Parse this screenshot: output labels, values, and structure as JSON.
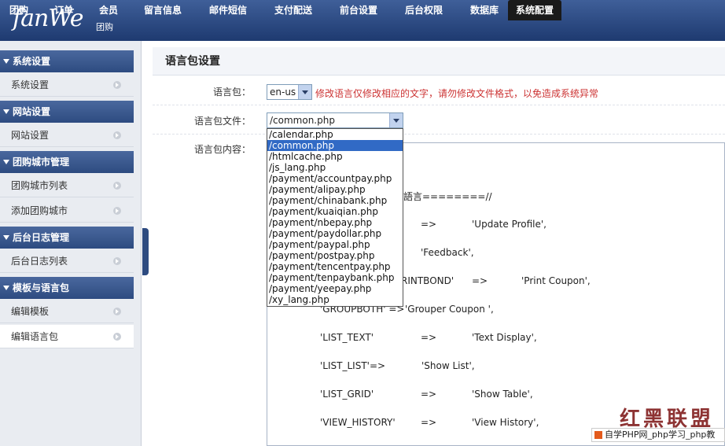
{
  "brand": {
    "logo": "fanWe",
    "sub": "团购"
  },
  "nav": [
    {
      "label": "团购",
      "active": false
    },
    {
      "label": "订单",
      "active": false
    },
    {
      "label": "会员",
      "active": false
    },
    {
      "label": "留言信息",
      "active": false
    },
    {
      "label": "邮件短信",
      "active": false
    },
    {
      "label": "支付配送",
      "active": false
    },
    {
      "label": "前台设置",
      "active": false
    },
    {
      "label": "后台权限",
      "active": false
    },
    {
      "label": "数据库",
      "active": false
    },
    {
      "label": "系统配置",
      "active": true
    }
  ],
  "sidebar": {
    "sections": [
      {
        "title": "系统设置",
        "items": [
          "系统设置"
        ]
      },
      {
        "title": "网站设置",
        "items": [
          "网站设置"
        ]
      },
      {
        "title": "团购城市管理",
        "items": [
          "团购城市列表",
          "添加团购城市"
        ]
      },
      {
        "title": "后台日志管理",
        "items": [
          "后台日志列表"
        ]
      },
      {
        "title": "模板与语言包",
        "items": [
          "编辑模板",
          "编辑语言包"
        ]
      }
    ],
    "current": "编辑语言包"
  },
  "main": {
    "title": "语言包设置",
    "lang_label": "语言包：",
    "lang_value": "en-us",
    "warning": "修改语言仅修改相应的文字，请勿修改文件格式，以免造成系统异常",
    "file_label": "语言包文件：",
    "file_value": "/common.php",
    "content_label": "语言包内容：",
    "file_options": [
      "/calendar.php",
      "/common.php",
      "/htmlcache.php",
      "/js_lang.php",
      "/payment/accountpay.php",
      "/payment/alipay.php",
      "/payment/chinabank.php",
      "/payment/kuaiqian.php",
      "/payment/nbepay.php",
      "/payment/paydollar.php",
      "/payment/paypal.php",
      "/payment/postpay.php",
      "/payment/tencentpay.php",
      "/payment/tenpaybank.php",
      "/payment/yeepay.php",
      "/xy_lang.php"
    ],
    "selected_option": "/common.php",
    "code_lines": {
      "l1": "語言========//",
      "l2a": "=>",
      "l2b": "'Update Profile',",
      "l3": "'Feedback',",
      "l4a": "RINTBOND'",
      "l4b": "=>",
      "l4c": "'Print Coupon',",
      "l5a": "'GROUPBOTH' =>",
      "l5b": "'Grouper Coupon ',",
      "l6a": "'LIST_TEXT'",
      "l6b": "=>",
      "l6c": "'Text Display',",
      "l7a": "'LIST_LIST'=>",
      "l7b": "'Show List',",
      "l8a": "'LIST_GRID'",
      "l8b": "=>",
      "l8c": "'Show Table',",
      "l9a": "'VIEW_HISTORY'",
      "l9b": "=>",
      "l9c": "'View History',"
    }
  },
  "watermark": {
    "stamp": "红黑联盟",
    "bar": "自学PHP网_php学习_php教"
  }
}
